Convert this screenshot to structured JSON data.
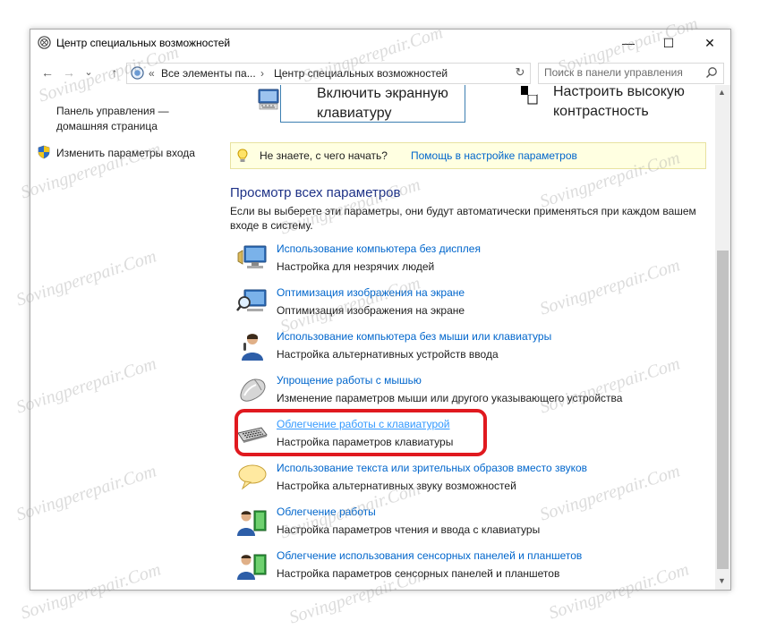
{
  "window": {
    "title": "Центр специальных возможностей",
    "controls": {
      "minimize": "—",
      "maximize": "☐",
      "close": "✕"
    }
  },
  "navbar": {
    "back": "←",
    "forward": "→",
    "recent": "⌄",
    "up": "↑",
    "address_prefix": "«",
    "address_parts": [
      "Все элементы па...",
      "›",
      "Центр специальных возможностей"
    ],
    "dropdown": "⌄",
    "refresh": "↻",
    "search_placeholder": "Поиск в панели управления"
  },
  "left_pane": {
    "home_link": "Панель управления — домашняя страница",
    "logon_link": "Изменить параметры входа"
  },
  "top_items": [
    {
      "label": "Включить экранную клавиатуру",
      "icon": "on-screen-keyboard-icon"
    },
    {
      "label": "Настроить высокую контрастность",
      "icon": "high-contrast-icon"
    }
  ],
  "tip": {
    "question": "Не знаете, с чего начать?",
    "link": "Помощь в настройке параметров",
    "icon": "lightbulb-icon"
  },
  "section": {
    "title": "Просмотр всех параметров",
    "description": "Если вы выберете эти параметры, они будут автоматически применяться при каждом вашем входе в систему."
  },
  "options": [
    {
      "title": "Использование компьютера без дисплея",
      "subtitle": "Настройка для незрячих людей",
      "icon": "monitor-speaker-icon"
    },
    {
      "title": "Оптимизация изображения на экране",
      "subtitle": "Оптимизация изображения на экране",
      "icon": "monitor-magnifier-icon"
    },
    {
      "title": "Использование компьютера без мыши или клавиатуры",
      "subtitle": "Настройка альтернативных устройств ввода",
      "icon": "person-microphone-icon"
    },
    {
      "title": "Упрощение работы с мышью",
      "subtitle": "Изменение параметров мыши или другого указывающего устройства",
      "icon": "mouse-icon"
    },
    {
      "title": "Облегчение работы с клавиатурой",
      "subtitle": "Настройка параметров клавиатуры",
      "icon": "keyboard-icon"
    },
    {
      "title": "Использование текста или зрительных образов вместо звуков",
      "subtitle": "Настройка альтернативных звуку возможностей",
      "icon": "speech-bubble-icon"
    },
    {
      "title": "Облегчение работы",
      "subtitle": "Настройка параметров чтения и ввода с клавиатуры",
      "icon": "person-book-icon"
    },
    {
      "title": "Облегчение использования сенсорных панелей и планшетов",
      "subtitle": "Настройка параметров сенсорных панелей и планшетов",
      "icon": "person-tablet-icon"
    }
  ],
  "watermark": "Sovingperepair.Com",
  "colors": {
    "link": "#0066cc",
    "heading": "#1e3287",
    "highlight": "#e0191f",
    "tip_bg": "#ffffe1"
  }
}
